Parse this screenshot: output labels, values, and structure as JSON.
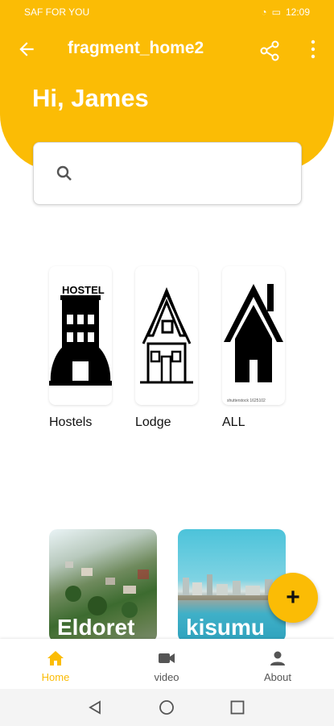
{
  "status": {
    "carrier": "SAF FOR YOU",
    "time": "12:09"
  },
  "appbar": {
    "title": "fragment_home2"
  },
  "hero": {
    "greeting": "Hi, James"
  },
  "search": {
    "placeholder": ""
  },
  "categories": [
    {
      "label": "Hostels",
      "icon": "hostel-building-icon",
      "sign": "HOSTEL"
    },
    {
      "label": "Lodge",
      "icon": "lodge-house-icon"
    },
    {
      "label": "ALL",
      "icon": "house-icon",
      "caption": "shutterstock 1625102"
    }
  ],
  "places": [
    {
      "name": "Eldoret",
      "image": "aerial-city-photo"
    },
    {
      "name": "kisumu",
      "image": "lakeside-city-photo"
    }
  ],
  "fab": {
    "label": "+"
  },
  "bottom_nav": [
    {
      "label": "Home",
      "icon": "home-icon",
      "active": true
    },
    {
      "label": "video",
      "icon": "video-camera-icon",
      "active": false
    },
    {
      "label": "About",
      "icon": "person-icon",
      "active": false
    }
  ],
  "colors": {
    "accent": "#fbbc05",
    "text": "#111111"
  }
}
